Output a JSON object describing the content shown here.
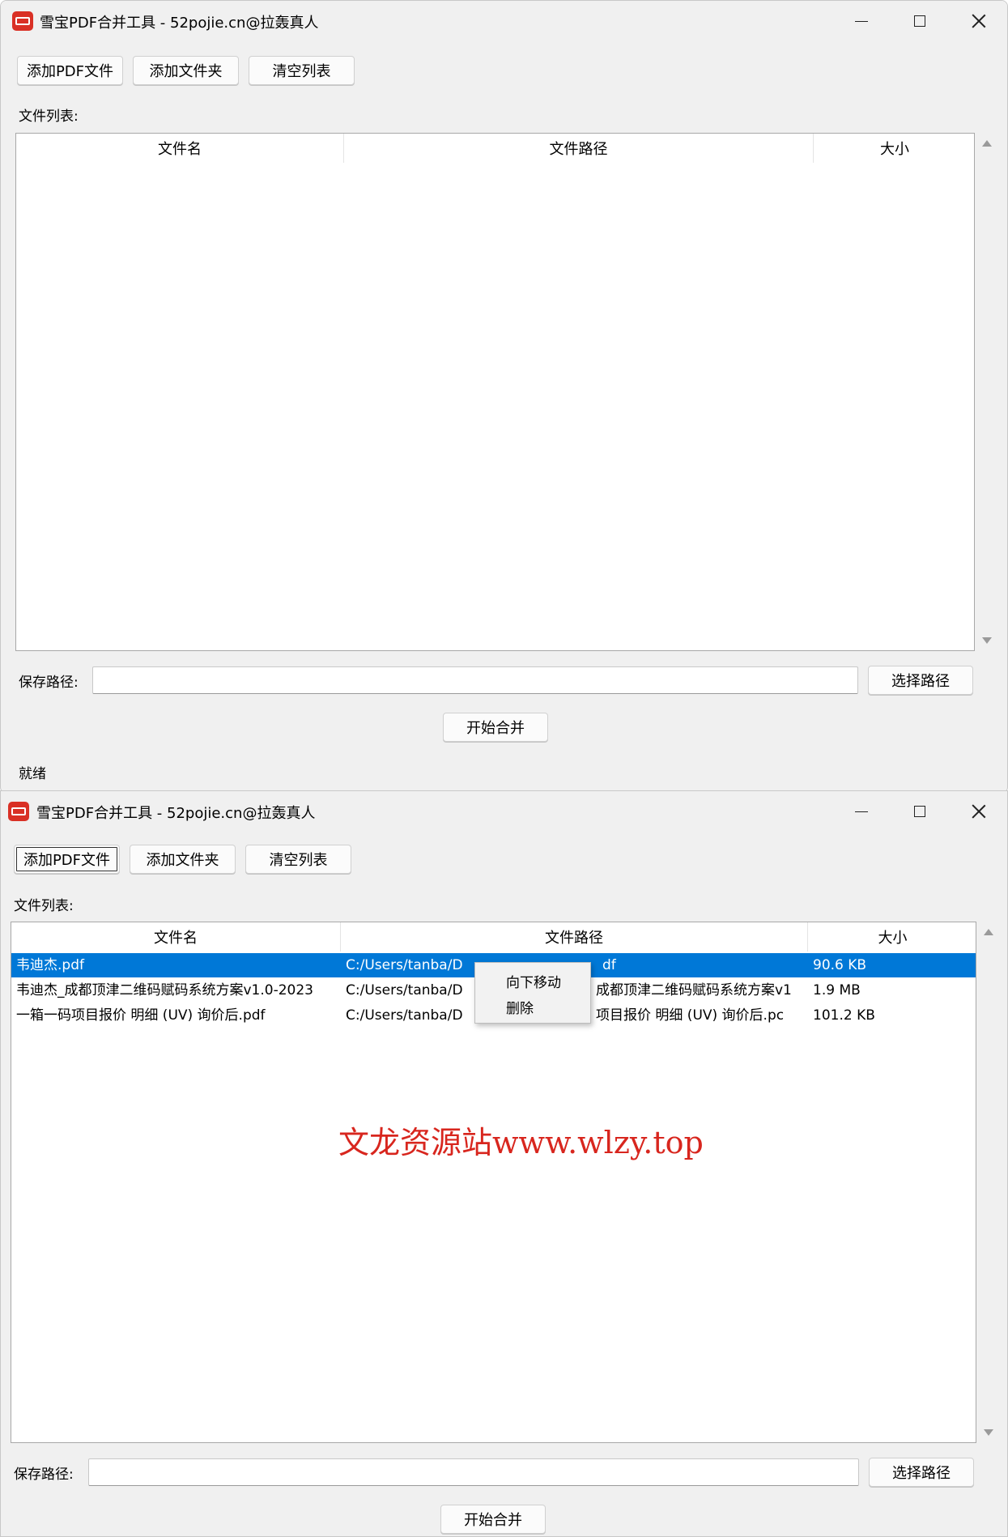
{
  "window_title": "雪宝PDF合并工具 - 52pojie.cn@拉轰真人",
  "toolbar": {
    "add_pdf": "添加PDF文件",
    "add_folder": "添加文件夹",
    "clear_list": "清空列表"
  },
  "file_list_label": "文件列表:",
  "columns": {
    "name": "文件名",
    "path": "文件路径",
    "size": "大小"
  },
  "save_path_label": "保存路径:",
  "save_path_value": "",
  "choose_path": "选择路径",
  "start_merge": "开始合并",
  "status": "就绪",
  "files": [
    {
      "name": "韦迪杰.pdf",
      "path": "C:/Users/tanba/D",
      "path_tail": "df",
      "size": "90.6 KB"
    },
    {
      "name": "韦迪杰_成都顶津二维码赋码系统方案v1.0-2023",
      "path": "C:/Users/tanba/D",
      "path_tail": "成都顶津二维码赋码系统方案v1",
      "size": "1.9 MB"
    },
    {
      "name": "一箱一码项目报价 明细 (UV) 询价后.pdf",
      "path": "C:/Users/tanba/D",
      "path_tail": "项目报价 明细 (UV) 询价后.pc",
      "size": "101.2 KB"
    }
  ],
  "context_menu": {
    "move_down": "向下移动",
    "delete": "删除"
  },
  "watermark": "文龙资源站www.wlzy.top",
  "colors": {
    "selection": "#0078d7",
    "watermark": "#d8261e",
    "app_icon": "#d93025"
  }
}
